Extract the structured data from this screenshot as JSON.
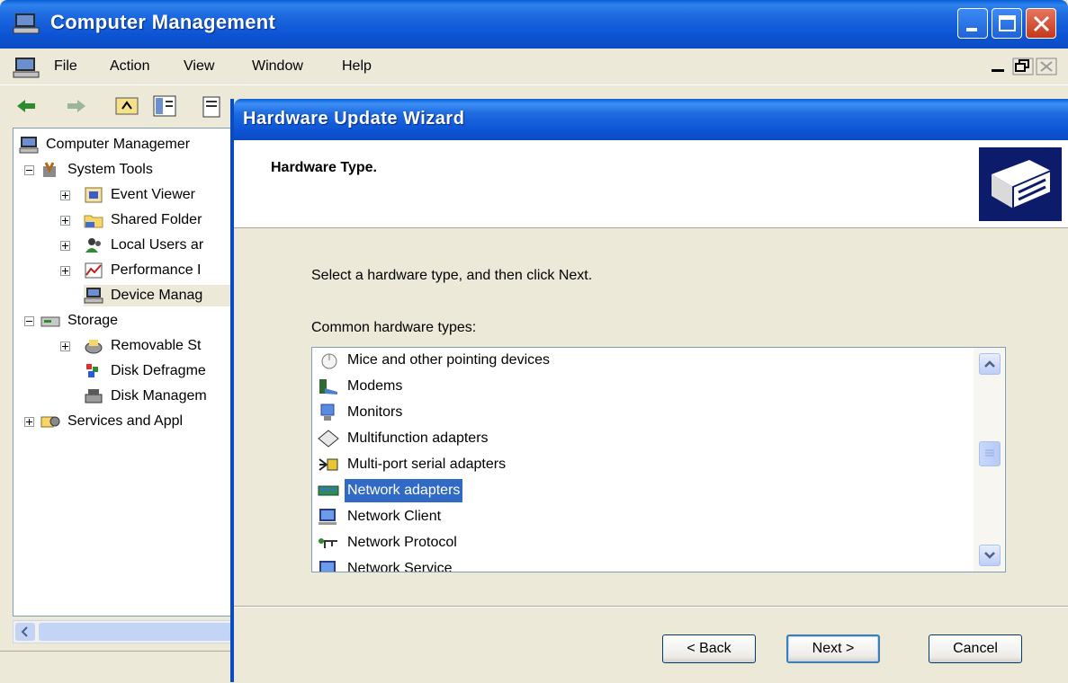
{
  "window": {
    "title": "Computer Management",
    "menu": [
      "File",
      "Action",
      "View",
      "Window",
      "Help"
    ]
  },
  "tree": {
    "items": [
      {
        "label": "Computer Managemer",
        "icon": "computer-icon"
      },
      {
        "label": "System Tools",
        "icon": "system-tools-icon"
      },
      {
        "label": "Event Viewer",
        "icon": "event-viewer-icon"
      },
      {
        "label": "Shared Folder",
        "icon": "folder-icon"
      },
      {
        "label": "Local Users ar",
        "icon": "users-icon"
      },
      {
        "label": "Performance I",
        "icon": "performance-icon"
      },
      {
        "label": "Device Manag",
        "icon": "device-manager-icon"
      },
      {
        "label": "Storage",
        "icon": "storage-icon"
      },
      {
        "label": "Removable St",
        "icon": "removable-storage-icon"
      },
      {
        "label": "Disk Defragme",
        "icon": "defrag-icon"
      },
      {
        "label": "Disk Managem",
        "icon": "disk-management-icon"
      },
      {
        "label": "Services and Appl",
        "icon": "services-icon"
      }
    ]
  },
  "wizard": {
    "title": "Hardware Update Wizard",
    "heading": "Hardware Type.",
    "instruction": "Select a hardware type, and then click Next.",
    "list_caption": "Common hardware types:",
    "list_items": [
      {
        "label": "Mice and other pointing devices",
        "icon": "mouse-icon"
      },
      {
        "label": "Modems",
        "icon": "modem-icon"
      },
      {
        "label": "Monitors",
        "icon": "monitor-icon"
      },
      {
        "label": "Multifunction adapters",
        "icon": "multifunction-icon"
      },
      {
        "label": "Multi-port serial adapters",
        "icon": "serial-adapter-icon"
      },
      {
        "label": "Network adapters",
        "icon": "network-adapter-icon",
        "selected": true
      },
      {
        "label": "Network Client",
        "icon": "network-client-icon"
      },
      {
        "label": "Network Protocol",
        "icon": "network-protocol-icon"
      },
      {
        "label": "Network Service",
        "icon": "network-service-icon"
      }
    ],
    "buttons": {
      "back": "< Back",
      "next": "Next >",
      "cancel": "Cancel"
    }
  },
  "colors": {
    "titlebar": "#0A4BC2",
    "selection": "#316AC5",
    "face": "#ECE9D8"
  }
}
